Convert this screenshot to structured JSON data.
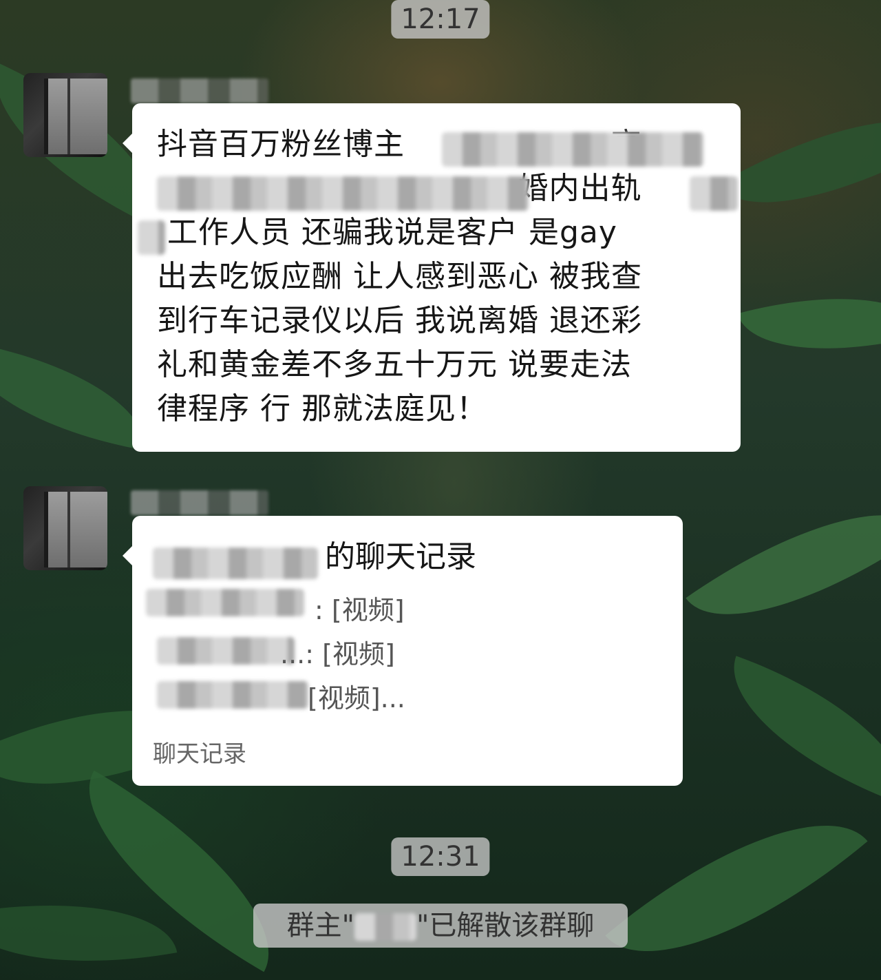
{
  "chat": {
    "timestamps": [
      "12:17",
      "12:31"
    ],
    "messages": [
      {
        "type": "text",
        "text": "抖音百万粉丝博主                    高\n                                   婚内出轨\n 工作人员 还骗我说是客户 是gay\n出去吃饭应酬 让人感到恶心 被我查\n到行车记录仪以后 我说离婚 退还彩\n礼和黄金差不多五十万元 说要走法\n律程序 行 那就法庭见！"
      },
      {
        "type": "forwarded",
        "title_suffix": "的聊天记录",
        "lines": [
          ": [视频]",
          "...: [视频]",
          " [视频]..."
        ],
        "footer": "聊天记录"
      }
    ],
    "system_notice_prefix": "群主\"",
    "system_notice_suffix": "\"已解散该群聊"
  }
}
